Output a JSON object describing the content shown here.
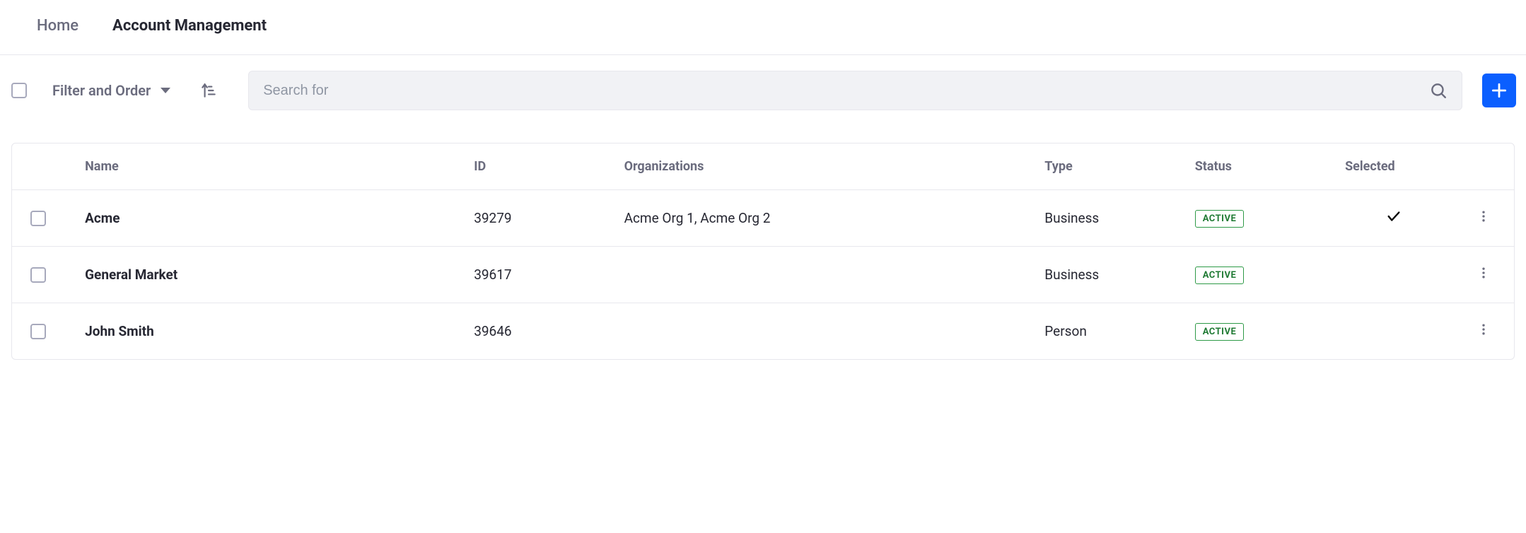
{
  "breadcrumb": {
    "home": "Home",
    "current": "Account Management"
  },
  "toolbar": {
    "filter_label": "Filter and Order",
    "search_placeholder": "Search for"
  },
  "table": {
    "columns": {
      "name": "Name",
      "id": "ID",
      "organizations": "Organizations",
      "type": "Type",
      "status": "Status",
      "selected": "Selected"
    },
    "rows": [
      {
        "name": "Acme",
        "id": "39279",
        "organizations": "Acme Org 1, Acme Org 2",
        "type": "Business",
        "status": "ACTIVE",
        "selected": true
      },
      {
        "name": "General Market",
        "id": "39617",
        "organizations": "",
        "type": "Business",
        "status": "ACTIVE",
        "selected": false
      },
      {
        "name": "John Smith",
        "id": "39646",
        "organizations": "",
        "type": "Person",
        "status": "ACTIVE",
        "selected": false
      }
    ]
  }
}
